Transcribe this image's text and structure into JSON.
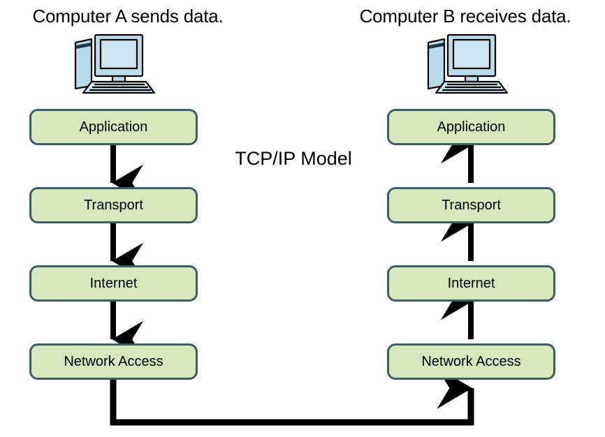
{
  "diagram": {
    "title": "TCP/IP Model",
    "background_color": "#ffffff",
    "box_fill_color": "#d9e5bb",
    "box_border_color": "#3d5c69",
    "arrow_color": "#000000",
    "computer_body_color": "#b9dcea",
    "computer_outline_color": "#000000"
  },
  "captions": {
    "left": "Computer A sends data.",
    "right": "Computer B receives data."
  },
  "icons": {
    "left_computer": "desktop-computer-icon",
    "right_computer": "desktop-computer-icon"
  },
  "left_stack": {
    "direction": "down",
    "layers": [
      {
        "label": "Application"
      },
      {
        "label": "Transport"
      },
      {
        "label": "Internet"
      },
      {
        "label": "Network Access"
      }
    ]
  },
  "right_stack": {
    "direction": "up",
    "layers": [
      {
        "label": "Application"
      },
      {
        "label": "Transport"
      },
      {
        "label": "Internet"
      },
      {
        "label": "Network Access"
      }
    ]
  },
  "connection": {
    "label": "",
    "from": "Network Access (Computer A)",
    "to": "Network Access (Computer B)"
  }
}
